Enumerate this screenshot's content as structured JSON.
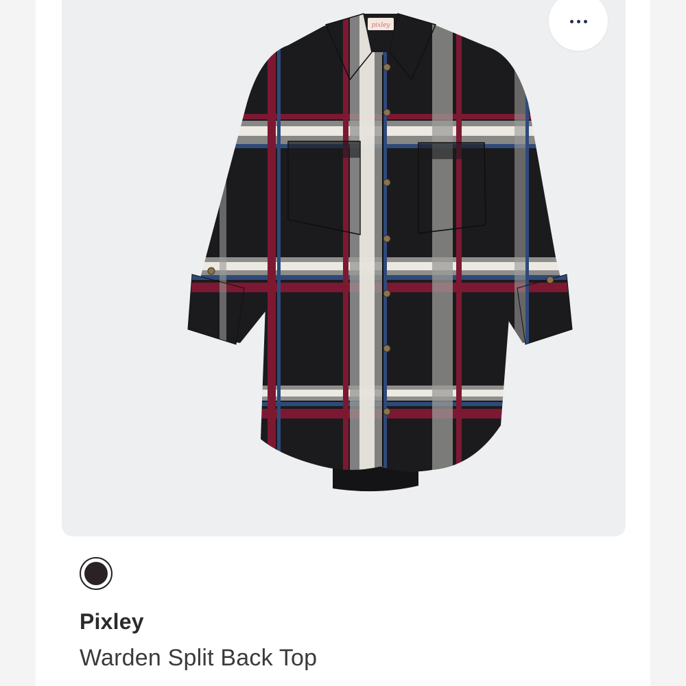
{
  "product": {
    "brand": "Pixley",
    "name": "Warden Split Back Top",
    "label_text": "pixley",
    "image_alt": "Black, red, blue and white plaid button-front shirt with roll-tab sleeves and two chest pockets"
  },
  "swatches": [
    {
      "color": "#2a2224",
      "selected": true
    }
  ],
  "menu": {
    "icon": "more-horizontal-icon"
  },
  "colors": {
    "accent": "#1f2f5a",
    "plaid_black": "#1b1b1d",
    "plaid_red": "#7d1832",
    "plaid_blue": "#2f4a7a",
    "plaid_white": "#ece9e2",
    "plaid_gray": "#9a9a98"
  }
}
